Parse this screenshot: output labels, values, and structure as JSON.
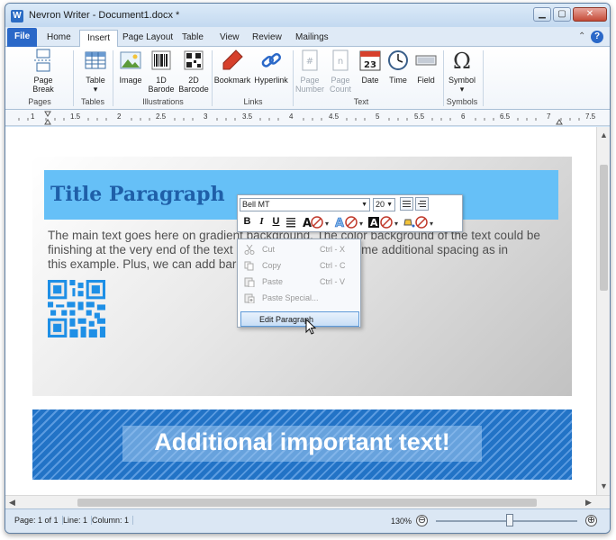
{
  "window": {
    "app_icon": "W",
    "title": "Nevron Writer - Document1.docx *"
  },
  "tabs": [
    "File",
    "Home",
    "Insert",
    "Page Layout",
    "Table",
    "View",
    "Review",
    "Mailings"
  ],
  "active_tab": "Insert",
  "ribbon": {
    "groups": [
      "Pages",
      "Tables",
      "Illustrations",
      "Links",
      "Text",
      "Symbols"
    ],
    "buttons": [
      {
        "line1": "Page",
        "line2": "Break",
        "icon": "page-break-icon",
        "disabled": false
      },
      {
        "line1": "Table",
        "line2": "▾",
        "icon": "table-icon",
        "disabled": false
      },
      {
        "line1": "Image",
        "line2": "",
        "icon": "image-icon",
        "disabled": false
      },
      {
        "line1": "1D",
        "line2": "Barode",
        "icon": "barcode-1d-icon",
        "disabled": false
      },
      {
        "line1": "2D",
        "line2": "Barcode",
        "icon": "barcode-2d-icon",
        "disabled": false
      },
      {
        "line1": "Bookmark",
        "line2": "",
        "icon": "bookmark-icon",
        "disabled": false
      },
      {
        "line1": "Hyperlink",
        "line2": "",
        "icon": "hyperlink-icon",
        "disabled": false
      },
      {
        "line1": "Page",
        "line2": "Number",
        "icon": "page-number-icon",
        "disabled": true
      },
      {
        "line1": "Page",
        "line2": "Count",
        "icon": "page-count-icon",
        "disabled": true
      },
      {
        "line1": "Date",
        "line2": "",
        "icon": "calendar-icon",
        "disabled": false
      },
      {
        "line1": "Time",
        "line2": "",
        "icon": "clock-icon",
        "disabled": false
      },
      {
        "line1": "Field",
        "line2": "",
        "icon": "field-icon",
        "disabled": false
      },
      {
        "line1": "Symbol",
        "line2": "▾",
        "icon": "omega-icon",
        "disabled": false
      }
    ],
    "date_icon_text": "23"
  },
  "ruler": {
    "labels": [
      "1",
      "1.5",
      "2",
      "2.5",
      "3",
      "3.5",
      "4",
      "4.5",
      "5",
      "5.5",
      "6",
      "6.5",
      "7",
      "7.5"
    ]
  },
  "document": {
    "title_paragraph": "Title Paragraph",
    "body_text": "The main text goes here on gradient background. The color background of the text could be finishing at the very end of the text i... leaving some additional spacing as in this example. Plus, we can add barc...",
    "body_lines": [
      "The main text goes here on gradient background. The color background of the text could be",
      "finishing at the very end of the text i                    leaving some additional spacing as in",
      "this example. Plus, we can add barc"
    ],
    "banner_text": "Additional important text!",
    "colors": {
      "title_band": "#66c0f7",
      "title_text": "#1f5fa8",
      "banner": "#2273c6"
    }
  },
  "mini_toolbar": {
    "font_name": "Bell MT",
    "font_size": "20",
    "buttons": [
      "B",
      "I",
      "U"
    ]
  },
  "context_menu": {
    "items": [
      {
        "label": "Cut",
        "shortcut": "Ctrl - X",
        "icon": "scissors-icon",
        "enabled": false
      },
      {
        "label": "Copy",
        "shortcut": "Ctrl - C",
        "icon": "copy-icon",
        "enabled": false
      },
      {
        "label": "Paste",
        "shortcut": "Ctrl - V",
        "icon": "paste-icon",
        "enabled": false
      },
      {
        "label": "Paste Special...",
        "shortcut": "",
        "icon": "paste-special-icon",
        "enabled": false
      },
      {
        "label": "Edit Paragraph",
        "shortcut": "",
        "icon": "",
        "enabled": true,
        "highlighted": true
      }
    ]
  },
  "status": {
    "page": "Page: 1 of 1",
    "line": "Line: 1",
    "column": "Column: 1",
    "zoom": "130%",
    "zoom_out": "⊖",
    "zoom_in": "⊕"
  }
}
